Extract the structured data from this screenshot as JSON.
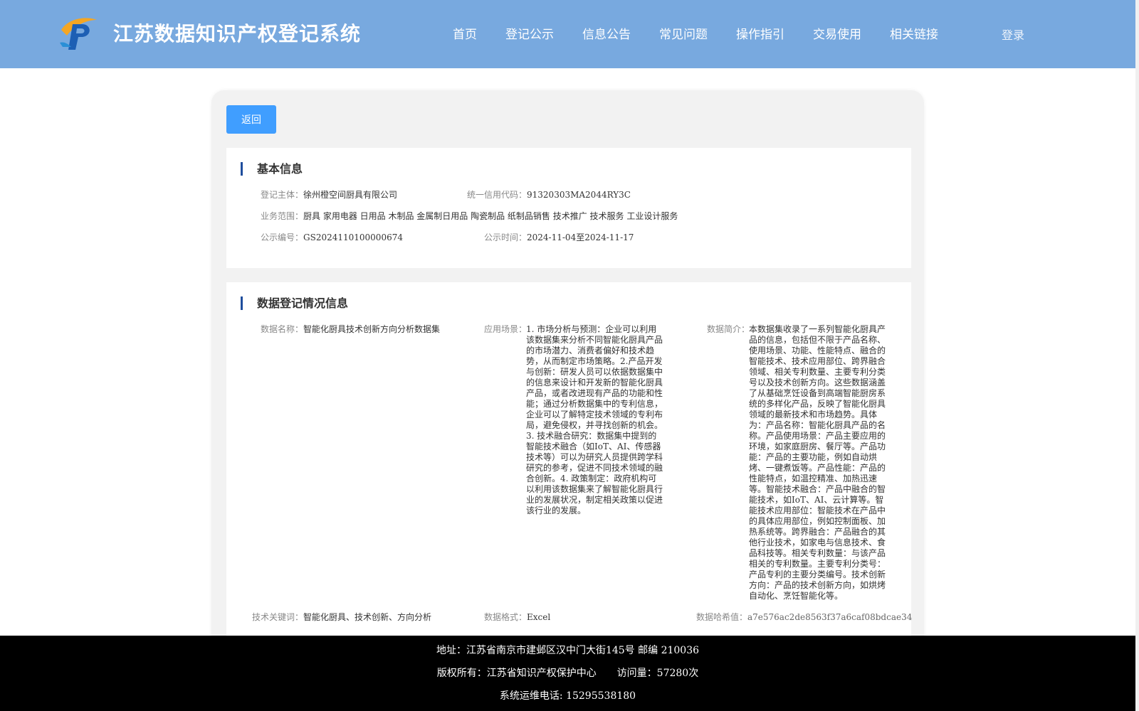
{
  "header": {
    "title": "江苏数据知识产权登记系统",
    "nav": [
      "首页",
      "登记公示",
      "信息公告",
      "常见问题",
      "操作指引",
      "交易使用",
      "相关链接"
    ],
    "login": "登录"
  },
  "colors": {
    "header_bg": "#78a9df",
    "primary": "#409eff",
    "accent_bar": "#1f4e9d",
    "footer_bg": "#000000"
  },
  "back_button": "返回",
  "basic_info": {
    "title": "基本信息",
    "subject_label": "登记主体：",
    "subject_value": "徐州橙空间厨具有限公司",
    "credit_label": "统一信用代码：",
    "credit_value": "91320303MA2044RY3C",
    "scope_label": "业务范围：",
    "scope_value": "厨具 家用电器 日用品 木制品 金属制日用品 陶瓷制品 纸制品销售 技术推广 技术服务 工业设计服务",
    "notice_no_label": "公示编号：",
    "notice_no_value": "GS2024110100000674",
    "notice_time_label": "公示时间：",
    "notice_time_value": "2024-11-04至2024-11-17"
  },
  "data_info": {
    "title": "数据登记情况信息",
    "name_label": "数据名称：",
    "name_value": "智能化厨具技术创新方向分析数据集",
    "scene_label": "应用场景：",
    "scene_value": "1. 市场分析与预测：企业可以利用该数据集来分析不同智能化厨具产品的市场潜力、消费者偏好和技术趋势，从而制定市场策略。2.产品开发与创新：研发人员可以依据数据集中的信息来设计和开发新的智能化厨具产品，或者改进现有产品的功能和性能；通过分析数据集中的专利信息，企业可以了解特定技术领域的专利布局，避免侵权，并寻找创新的机会。3. 技术融合研究：数据集中提到的智能技术融合（如IoT、AI、传感器技术等）可以为研究人员提供跨学科研究的参考，促进不同技术领域的融合创新。4. 政策制定：政府机构可以利用该数据集来了解智能化厨具行业的发展状况，制定相关政策以促进该行业的发展。",
    "intro_label": "数据简介：",
    "intro_value": "本数据集收录了一系列智能化厨具产品的信息，包括但不限于产品名称、使用场景、功能、性能特点、融合的智能技术、技术应用部位、跨界融合领域、相关专利数量、主要专利分类号以及技术创新方向。这些数据涵盖了从基础烹饪设备到高端智能厨房系统的多样化产品，反映了智能化厨具领域的最新技术和市场趋势。具体为：产品名称：智能化厨具产品的名称。产品使用场景：产品主要应用的环境，如家庭厨房、餐厅等。产品功能：产品的主要功能，例如自动烘烤、一键煮饭等。产品性能：产品的性能特点，如温控精准、加热迅速等。智能技术融合：产品中融合的智能技术，如IoT、AI、云计算等。智能技术应用部位：智能技术在产品中的具体应用部位，例如控制面板、加热系统等。跨界融合：产品融合的其他行业技术，如家电与信息技术、食品科技等。相关专利数量：与该产品相关的专利数量。主要专利分类号：产品专利的主要分类编号。技术创新方向：产品的技术创新方向，如烘烤自动化、烹饪智能化等。",
    "keywords_label": "技术关键词：",
    "keywords_value": "智能化厨具、技术创新、方向分析",
    "format_label": "数据格式：",
    "format_value": "Excel",
    "hash_label": "数据哈希值：",
    "hash_value": "a7e576ac2de8563f37a6caf08bdcae34"
  },
  "footer": {
    "address": "地址：江苏省南京市建邺区汉中门大街145号 邮编 210036",
    "copyright": "版权所有：江苏省知识产权保护中心",
    "visits": "访问量：57280次",
    "phone": "系统运维电话: 15295538180"
  }
}
